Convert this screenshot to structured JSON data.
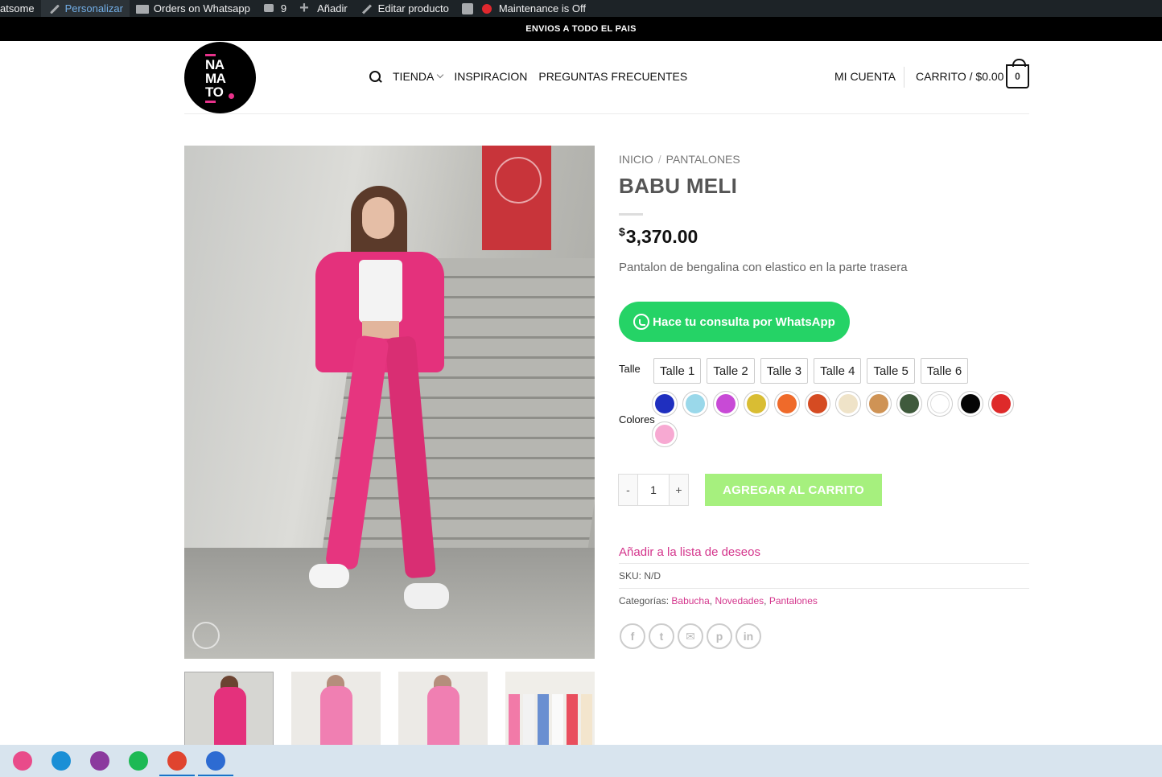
{
  "adminbar": {
    "items": [
      {
        "label": "atsome",
        "icon": ""
      },
      {
        "label": "Personalizar",
        "icon": "brush-icon"
      },
      {
        "label": "Orders on Whatsapp",
        "icon": "folder-icon"
      },
      {
        "label": "9",
        "icon": "comment-icon"
      },
      {
        "label": "Añadir",
        "icon": "plus-icon"
      },
      {
        "label": "Editar producto",
        "icon": "pencil-icon"
      },
      {
        "label": "",
        "icon": "yoast-icon"
      },
      {
        "label": "Maintenance is Off",
        "icon": "status-dot-icon"
      }
    ]
  },
  "topbar": {
    "text": "ENVIOS A TODO EL PAIS"
  },
  "header": {
    "logo": {
      "line1": "NA",
      "line2": "MA",
      "line3": "TO"
    },
    "nav": [
      "TIENDA",
      "INSPIRACION",
      "PREGUNTAS FRECUENTES"
    ],
    "account": "MI CUENTA",
    "cart_label": "CARRITO / $0.00",
    "cart_count": "0"
  },
  "breadcrumb": {
    "home": "INICIO",
    "separator": "/",
    "category": "PANTALONES"
  },
  "product": {
    "title": "BABU MELI",
    "currency": "$",
    "price": "3,370.00",
    "description": "Pantalon de bengalina con elastico en la parte trasera",
    "whatsapp_label": "Hace tu consulta por WhatsApp",
    "talle_label": "Talle",
    "talles": [
      "Talle 1",
      "Talle 2",
      "Talle 3",
      "Talle 4",
      "Talle 5",
      "Talle 6"
    ],
    "colores_label": "Colores",
    "colores": [
      "#1f2fbf",
      "#9ad8ea",
      "#c84ad6",
      "#d9bd33",
      "#ef6a2a",
      "#d54b22",
      "#efe3c8",
      "#cf9355",
      "#3f5a3c",
      "#ffffff",
      "#050505",
      "#de2a2a",
      "#f7a9d2"
    ],
    "quantity": {
      "minus": "-",
      "value": "1",
      "plus": "+"
    },
    "add_to_cart": "AGREGAR AL CARRITO",
    "wishlist": "Añadir a la lista de deseos",
    "sku_label": "SKU:",
    "sku_value": "N/D",
    "categories_label": "Categorías:",
    "categories": [
      "Babucha",
      "Novedades",
      "Pantalones"
    ],
    "share": [
      {
        "name": "facebook",
        "glyph": "f"
      },
      {
        "name": "twitter",
        "glyph": "t"
      },
      {
        "name": "email",
        "glyph": "✉"
      },
      {
        "name": "pinterest",
        "glyph": "p"
      },
      {
        "name": "linkedin",
        "glyph": "in"
      }
    ]
  },
  "colors": {
    "accent": "#d4358c",
    "whatsapp": "#25d366",
    "add_to_cart": "#a6f07e"
  },
  "taskbar": {
    "apps": [
      {
        "name": "snipping-tool-icon",
        "color": "#e94b8a",
        "running": false
      },
      {
        "name": "edge-icon",
        "color": "#1a8fd6",
        "running": false
      },
      {
        "name": "winrar-icon",
        "color": "#8b3a9e",
        "running": false
      },
      {
        "name": "spotify-icon",
        "color": "#1db954",
        "running": false
      },
      {
        "name": "chrome-icon",
        "color": "#e0442f",
        "running": true
      },
      {
        "name": "photos-icon",
        "color": "#2d6bd2",
        "running": true
      }
    ]
  }
}
